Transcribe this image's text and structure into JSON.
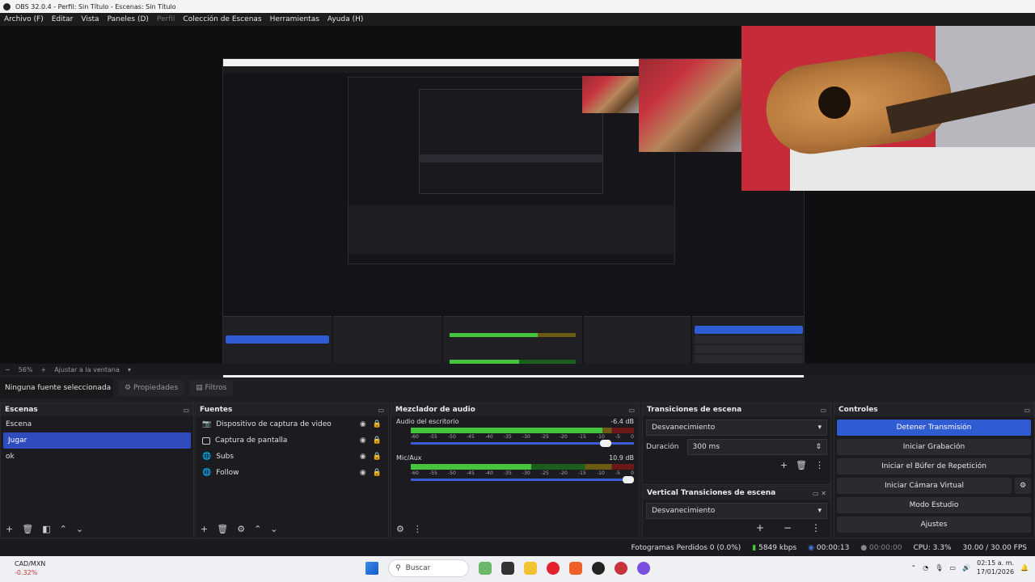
{
  "window": {
    "title": "OBS 32.0.4 - Perfil: Sin Título - Escenas: Sin Título"
  },
  "menu": [
    "Archivo (F)",
    "Editar",
    "Vista",
    "Paneles (D)",
    "Perfil",
    "Colección de Escenas",
    "Herramientas",
    "Ayuda (H)"
  ],
  "zoom": {
    "value": "56%",
    "fit_label": "Ajustar a la ventana"
  },
  "props": {
    "no_source": "Ninguna fuente seleccionada",
    "properties_label": "Propiedades",
    "filters_label": "Filtros"
  },
  "scenes": {
    "title": "Escenas",
    "items": [
      "Escena",
      "Jugar",
      "ok"
    ],
    "selected_index": 1
  },
  "sources": {
    "title": "Fuentes",
    "items": [
      {
        "name": "Dispositivo de captura de video",
        "icon": "camera-icon"
      },
      {
        "name": "Captura de pantalla",
        "icon": "monitor-icon"
      },
      {
        "name": "Subs",
        "icon": "globe-icon"
      },
      {
        "name": "Follow",
        "icon": "globe-icon"
      }
    ]
  },
  "mixer": {
    "title": "Mezclador de audio",
    "channels": [
      {
        "name": "Audio del escritorio",
        "db": "-6.4 dB",
        "level": 0.86,
        "volume": 0.9
      },
      {
        "name": "Mic/Aux",
        "db": "10.9 dB",
        "level": 0.54,
        "volume": 1.0
      }
    ],
    "ticks": [
      "-60",
      "-55",
      "-50",
      "-45",
      "-40",
      "-35",
      "-30",
      "-25",
      "-20",
      "-15",
      "-10",
      "-5",
      "0"
    ]
  },
  "transitions": {
    "title": "Transiciones de escena",
    "selected": "Desvanecimiento",
    "duration_label": "Duración",
    "duration_value": "300 ms"
  },
  "vertical": {
    "title": "Vertical Transiciones de escena",
    "selected": "Desvanecimiento"
  },
  "controls": {
    "title": "Controles",
    "buttons": [
      "Detener Transmisión",
      "Iniciar Grabación",
      "Iniciar el Búfer de Repetición",
      "Iniciar Cámara Virtual",
      "Modo Estudio",
      "Ajustes"
    ]
  },
  "status": {
    "dropped": "Fotogramas Perdidos 0 (0.0%)",
    "bitrate": "5849 kbps",
    "time": "00:00:13",
    "rec_time": "00:00:00",
    "cpu": "CPU: 3.3%",
    "fps": "30.00 / 30.00 FPS"
  },
  "taskbar": {
    "ticker": "CAD/MXN",
    "ticker_change": "-0.32%",
    "search": "Buscar",
    "time": "02:15 a. m.",
    "date": "17/01/2026"
  },
  "colors": {
    "accent": "#2f5bd3",
    "selected_scene": "#2f4cbf"
  }
}
